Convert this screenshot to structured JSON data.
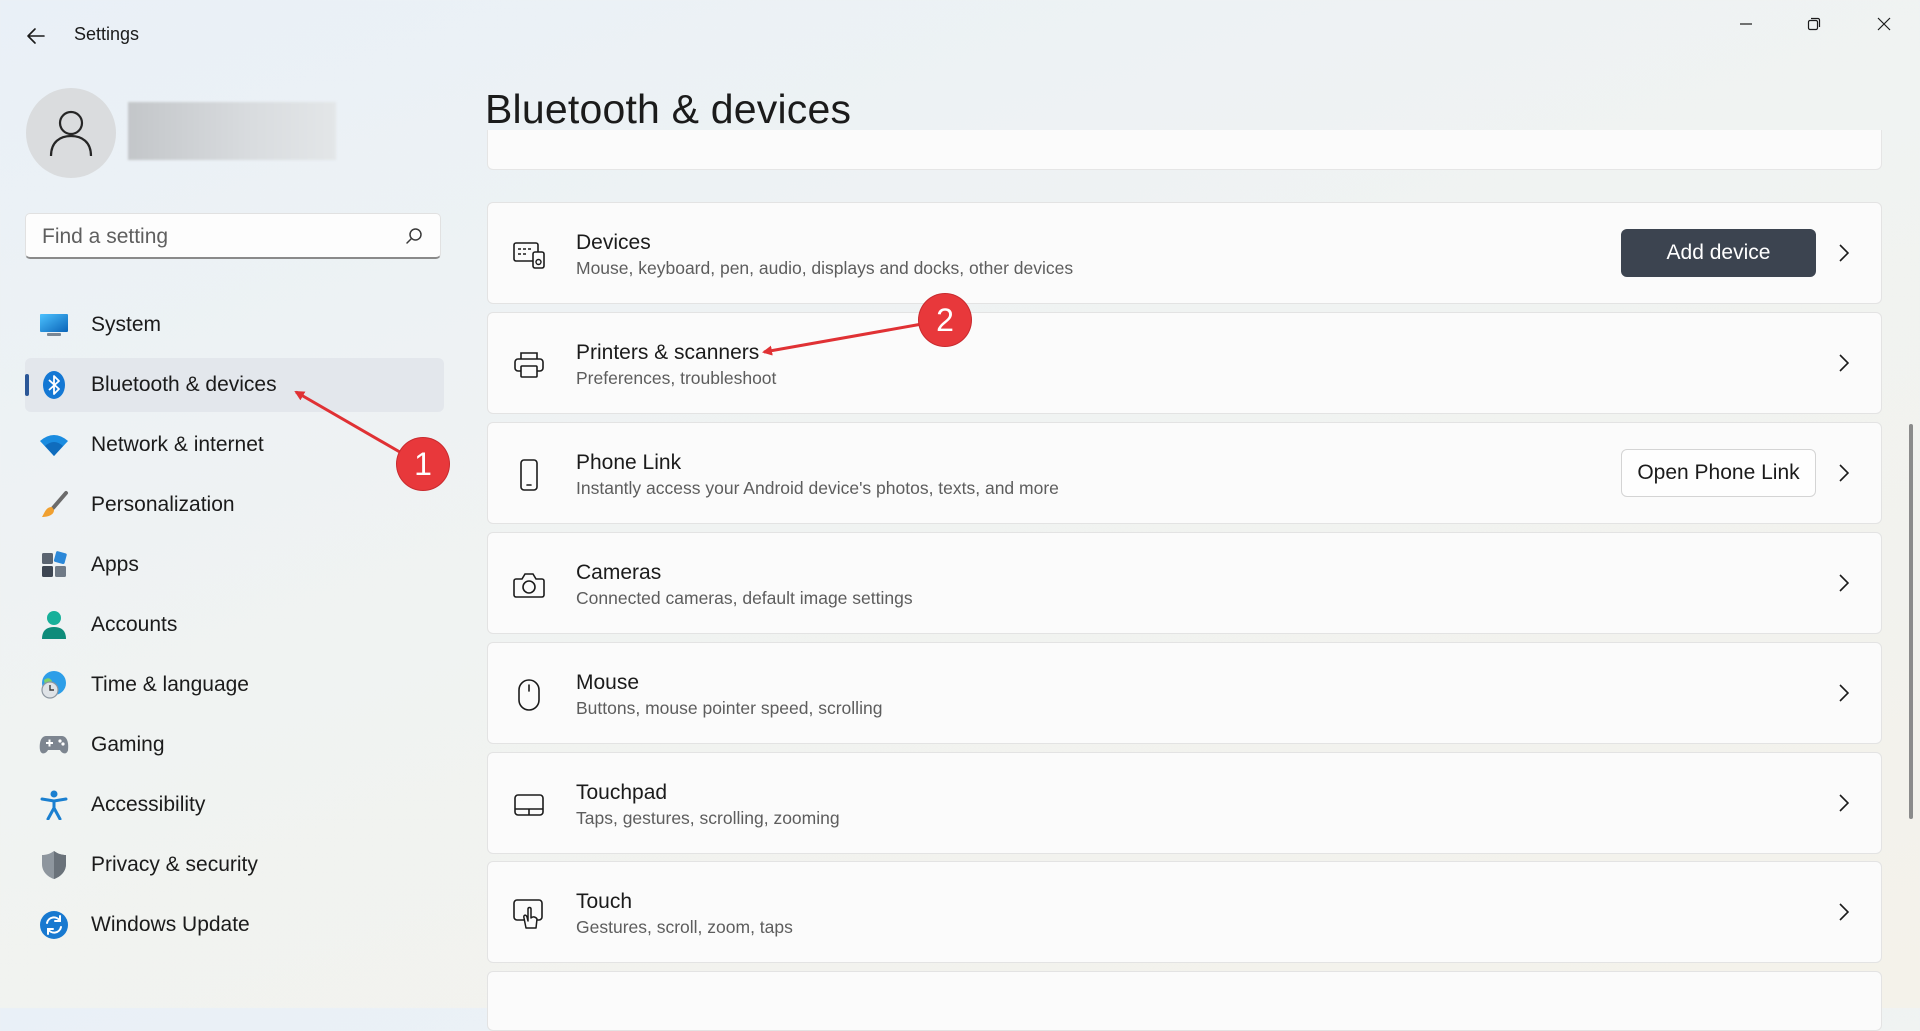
{
  "window": {
    "title": "Settings",
    "controls": [
      "minimize-icon",
      "maximize-icon",
      "close-icon"
    ]
  },
  "search": {
    "placeholder": "Find a setting"
  },
  "sidebar": {
    "items": [
      {
        "label": "System",
        "icon": "system-icon",
        "active": false
      },
      {
        "label": "Bluetooth & devices",
        "icon": "bluetooth-icon",
        "active": true
      },
      {
        "label": "Network & internet",
        "icon": "wifi-icon",
        "active": false
      },
      {
        "label": "Personalization",
        "icon": "brush-icon",
        "active": false
      },
      {
        "label": "Apps",
        "icon": "apps-icon",
        "active": false
      },
      {
        "label": "Accounts",
        "icon": "accounts-icon",
        "active": false
      },
      {
        "label": "Time & language",
        "icon": "globe-clock-icon",
        "active": false
      },
      {
        "label": "Gaming",
        "icon": "gamepad-icon",
        "active": false
      },
      {
        "label": "Accessibility",
        "icon": "accessibility-icon",
        "active": false
      },
      {
        "label": "Privacy & security",
        "icon": "shield-icon",
        "active": false
      },
      {
        "label": "Windows Update",
        "icon": "update-icon",
        "active": false
      }
    ]
  },
  "main": {
    "title": "Bluetooth & devices",
    "cards": [
      {
        "title": "Devices",
        "desc": "Mouse, keyboard, pen, audio, displays and docks, other devices",
        "icon": "devices-icon",
        "button": "Add device"
      },
      {
        "title": "Printers & scanners",
        "desc": "Preferences, troubleshoot",
        "icon": "printer-icon"
      },
      {
        "title": "Phone Link",
        "desc": "Instantly access your Android device's photos, texts, and more",
        "icon": "phone-icon",
        "button": "Open Phone Link"
      },
      {
        "title": "Cameras",
        "desc": "Connected cameras, default image settings",
        "icon": "camera-icon"
      },
      {
        "title": "Mouse",
        "desc": "Buttons, mouse pointer speed, scrolling",
        "icon": "mouse-icon"
      },
      {
        "title": "Touchpad",
        "desc": "Taps, gestures, scrolling, zooming",
        "icon": "touchpad-icon"
      },
      {
        "title": "Touch",
        "desc": "Gestures, scroll, zoom, taps",
        "icon": "touch-icon"
      }
    ]
  },
  "annotations": [
    {
      "number": "1",
      "color": "#e8383b"
    },
    {
      "number": "2",
      "color": "#e8383b"
    }
  ]
}
